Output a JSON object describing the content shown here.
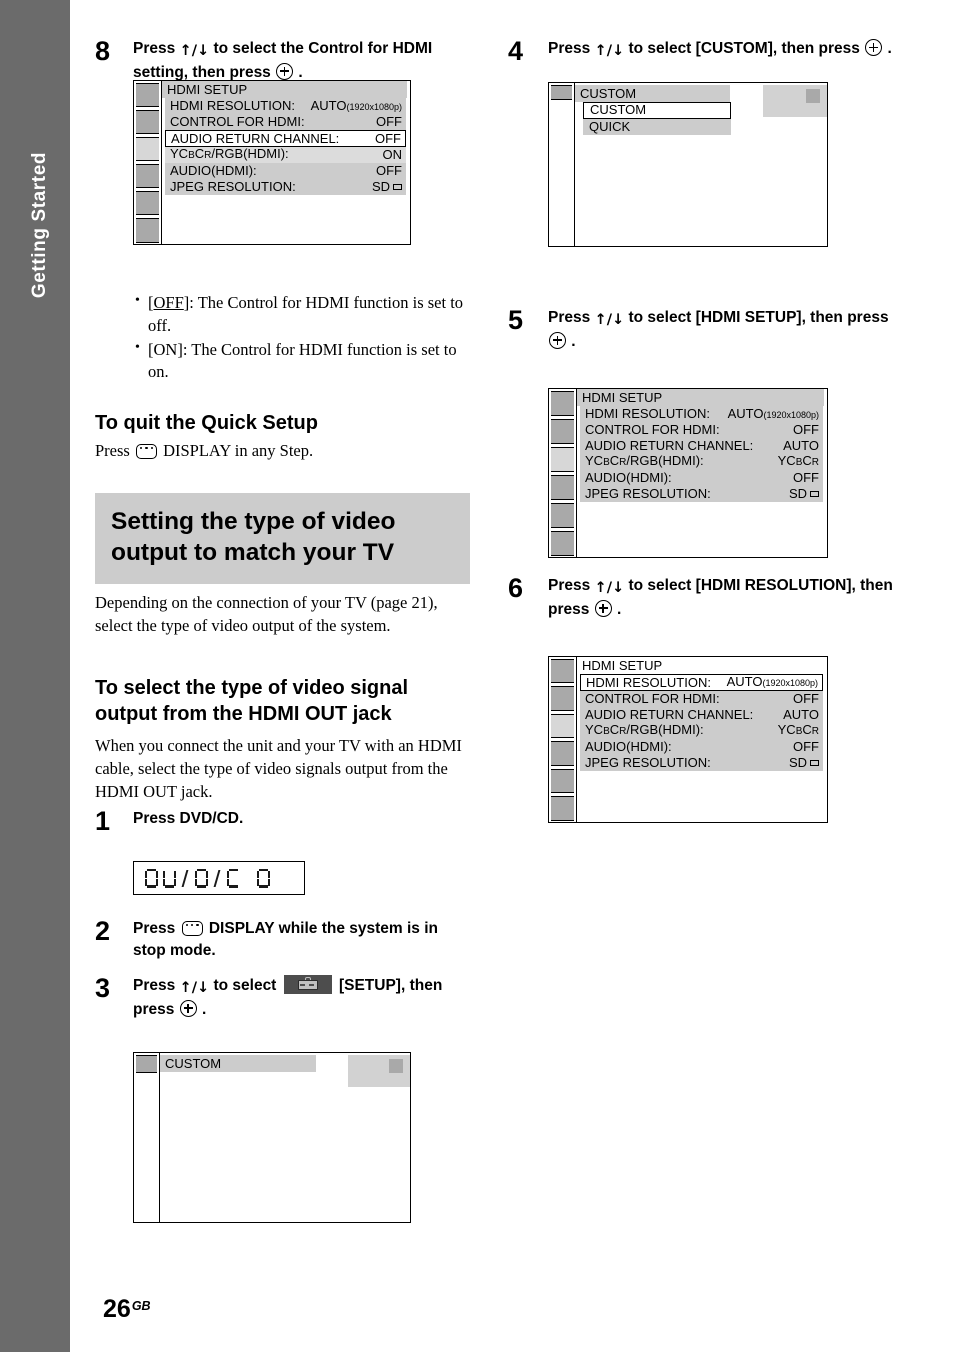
{
  "sidebar": {
    "tab_label": "Getting Started"
  },
  "footer": {
    "page_number": "26",
    "region": "GB"
  },
  "icons": {
    "updown": "↑/↓",
    "enter": "enter-button-icon",
    "display": "display-button-icon",
    "setup": "setup-suitcase-icon"
  },
  "left_column": {
    "step8": {
      "number": "8",
      "text_a": "Press ",
      "text_b": " to select the Control for HDMI setting, then press ",
      "text_c": " ."
    },
    "step8_osd": {
      "title": "HDMI SETUP",
      "rows": [
        {
          "label": "HDMI RESOLUTION:",
          "value": "AUTO",
          "value_sub": "(1920x1080p)",
          "state": "normal"
        },
        {
          "label": "CONTROL FOR HDMI:",
          "value": "OFF",
          "value_sub": "",
          "state": "normal"
        },
        {
          "label": "AUDIO RETURN CHANNEL:",
          "value": "OFF",
          "value_sub": "",
          "state": "selected-white"
        },
        {
          "label": "YCBCR/RGB(HDMI):",
          "value": "ON",
          "value_sub": "",
          "state": "light"
        },
        {
          "label": "AUDIO(HDMI):",
          "value": "OFF",
          "value_sub": "",
          "state": "normal"
        },
        {
          "label": "JPEG RESOLUTION:",
          "value": "SD",
          "value_sub": "",
          "state": "normal",
          "has_box_glyph": true
        }
      ],
      "icon_column_selected_index": 2,
      "icon_column_count": 6
    },
    "bullets": [
      {
        "term": "[OFF]",
        "term_underline": "OFF",
        "rest": ": The Control for HDMI function is set to off."
      },
      {
        "term": "[ON]",
        "term_underline": "",
        "rest": ": The Control for HDMI function is set to on."
      }
    ],
    "quit_heading": "To quit the Quick Setup",
    "quit_text_a": "Press ",
    "quit_text_b": " DISPLAY in any Step.",
    "band_heading": "Setting the type of video output to match your TV",
    "intro_paragraph": "Depending on the connection of your TV (page 21), select the type of video output of the system.",
    "subheading": "To select the type of video signal output from the HDMI OUT jack",
    "subparagraph": "When you connect the unit and your TV with an HDMI cable, select the type of video signals output from the HDMI OUT jack.",
    "step1": {
      "number": "1",
      "text": "Press DVD/CD."
    },
    "step1_lcd": {
      "text": "DVD/CD"
    },
    "step2": {
      "number": "2",
      "text_a": "Press ",
      "text_b": " DISPLAY while the system is in stop mode."
    },
    "step3": {
      "number": "3",
      "text_a": "Press ",
      "text_b": " to select ",
      "text_c": " [SETUP], then press ",
      "text_d": " ."
    },
    "step3_osd": {
      "title": "CUSTOM",
      "icon_column_count": 1
    }
  },
  "right_column": {
    "step4": {
      "number": "4",
      "text_a": "Press ",
      "text_b": " to select [CUSTOM], then press ",
      "text_c": " ."
    },
    "step4_osd": {
      "title": "CUSTOM",
      "options": [
        {
          "label": "CUSTOM",
          "state": "selected-white"
        },
        {
          "label": "QUICK",
          "state": "normal"
        }
      ]
    },
    "step5": {
      "number": "5",
      "text_a": "Press ",
      "text_b": " to select [HDMI SETUP], then press ",
      "text_c": " ."
    },
    "step5_osd": {
      "title": "HDMI SETUP",
      "rows": [
        {
          "label": "HDMI RESOLUTION:",
          "value": "AUTO",
          "value_sub": "(1920x1080p)",
          "state": "normal"
        },
        {
          "label": "CONTROL FOR HDMI:",
          "value": "OFF",
          "value_sub": "",
          "state": "normal"
        },
        {
          "label": "AUDIO RETURN CHANNEL:",
          "value": "AUTO",
          "value_sub": "",
          "state": "normal"
        },
        {
          "label": "YCBCR/RGB(HDMI):",
          "value": "YCBCR",
          "value_sub": "",
          "state": "normal"
        },
        {
          "label": "AUDIO(HDMI):",
          "value": "OFF",
          "value_sub": "",
          "state": "normal"
        },
        {
          "label": "JPEG RESOLUTION:",
          "value": "SD",
          "value_sub": "",
          "state": "normal",
          "has_box_glyph": true
        }
      ],
      "icon_column_selected_index": 2,
      "icon_column_count": 6
    },
    "step6": {
      "number": "6",
      "text_a": "Press ",
      "text_b": " to select [HDMI RESOLUTION], then press ",
      "text_c": " ."
    },
    "step6_osd": {
      "title": "HDMI SETUP",
      "rows": [
        {
          "label": "HDMI RESOLUTION:",
          "value": "AUTO",
          "value_sub": "(1920x1080p)",
          "state": "selected-white"
        },
        {
          "label": "CONTROL FOR HDMI:",
          "value": "OFF",
          "value_sub": "",
          "state": "normal"
        },
        {
          "label": "AUDIO RETURN CHANNEL:",
          "value": "AUTO",
          "value_sub": "",
          "state": "normal"
        },
        {
          "label": "YCBCR/RGB(HDMI):",
          "value": "YCBCR",
          "value_sub": "",
          "state": "normal"
        },
        {
          "label": "AUDIO(HDMI):",
          "value": "OFF",
          "value_sub": "",
          "state": "normal"
        },
        {
          "label": "JPEG RESOLUTION:",
          "value": "SD",
          "value_sub": "",
          "state": "normal",
          "has_box_glyph": true
        }
      ],
      "icon_column_selected_index": 2,
      "icon_column_count": 6
    }
  },
  "colors": {
    "sidebar_gray": "#6b6b6b",
    "band_gray": "#cccccc",
    "osd_row_gray": "#cccccc",
    "osd_icon_gray": "#a9a9a9",
    "osd_icon_selected": "#d7d7d7"
  }
}
